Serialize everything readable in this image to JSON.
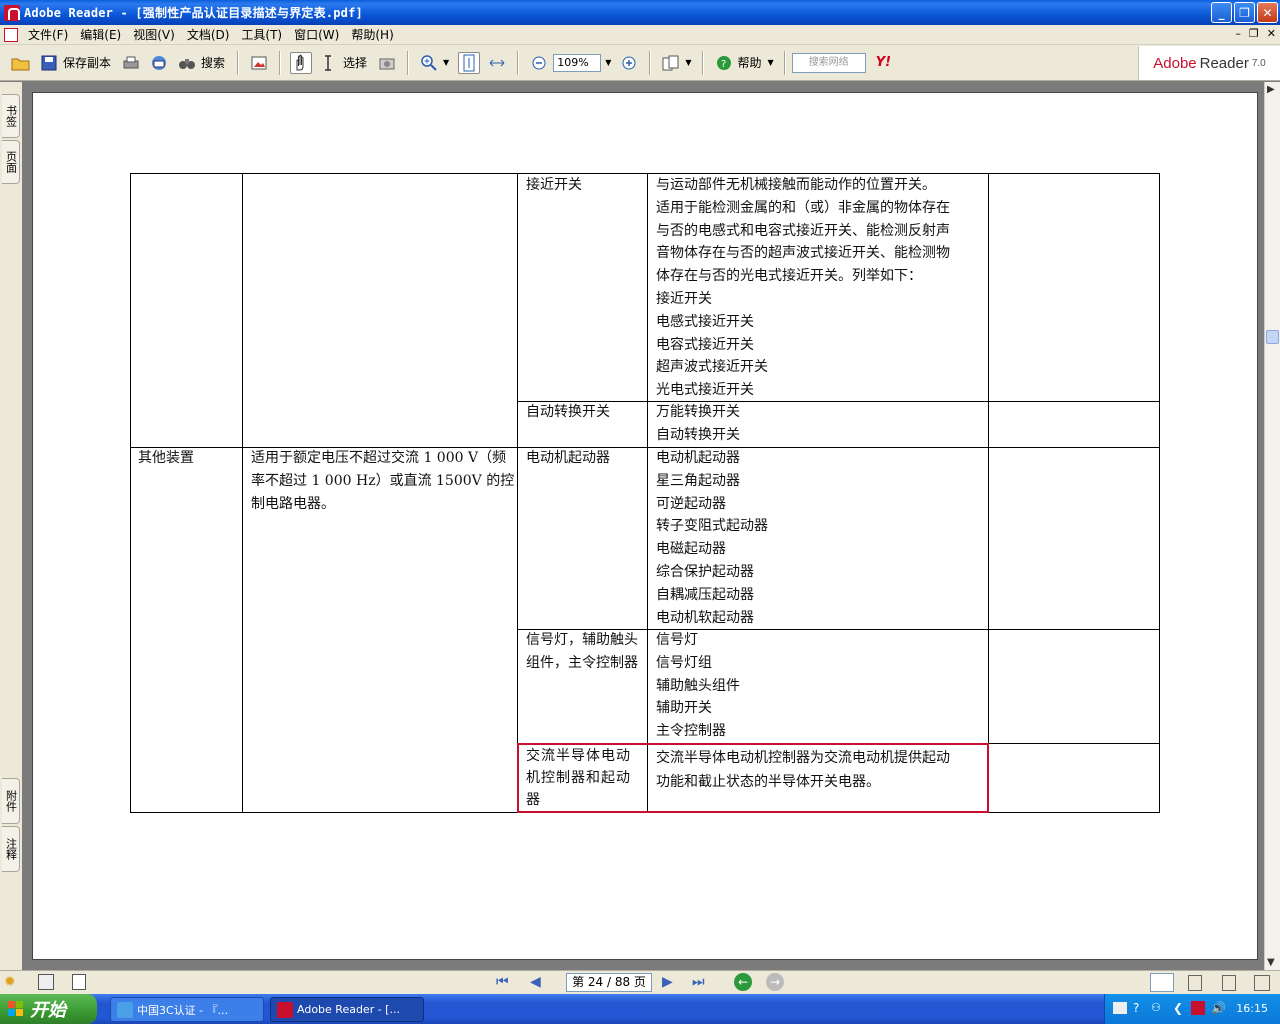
{
  "window": {
    "title": "Adobe Reader - [强制性产品认证目录描述与界定表.pdf]"
  },
  "menu": {
    "items": [
      "文件(F)",
      "编辑(E)",
      "视图(V)",
      "文档(D)",
      "工具(T)",
      "窗口(W)",
      "帮助(H)"
    ]
  },
  "toolbar": {
    "save_copy_label": "保存副本",
    "search_label": "搜索",
    "select_label": "选择",
    "zoom_value": "109%",
    "help_label": "帮助",
    "search_web_placeholder": "搜索网络",
    "yahoo_label": "Y!",
    "brand": {
      "adobe": "Adobe",
      "reader": "Reader",
      "version": "7.0"
    }
  },
  "sidenav": {
    "tabs_top": [
      "书签",
      "页面"
    ],
    "tabs_bottom": [
      "附件",
      "注释"
    ]
  },
  "table": {
    "rows": [
      {
        "col1": "",
        "col2": "",
        "col3": "接近开关",
        "col4": [
          "与运动部件无机械接触而能动作的位置开关。",
          "适用于能检测金属的和（或）非金属的物体存在",
          "与否的电感式和电容式接近开关、能检测反射声",
          "音物体存在与否的超声波式接近开关、能检测物",
          "体存在与否的光电式接近开关。列举如下：",
          "接近开关",
          "电感式接近开关",
          "电容式接近开关",
          "超声波式接近开关",
          "光电式接近开关"
        ]
      },
      {
        "col3": "自动转换开关",
        "col4": [
          "万能转换开关",
          "自动转换开关"
        ]
      },
      {
        "col1": "其他装置",
        "col2": [
          "适用于额定电压不超过交流 1 000 V（频",
          "率不超过 1 000 Hz）或直流 1500V 的控",
          "制电路电器。"
        ],
        "col3": "电动机起动器",
        "col4": [
          "电动机起动器",
          "星三角起动器",
          "可逆起动器",
          "转子变阻式起动器",
          "电磁起动器",
          "综合保护起动器",
          "自耦减压起动器",
          "电动机软起动器"
        ]
      },
      {
        "col3": [
          "信号灯，辅助触头",
          "组件，主令控制器"
        ],
        "col4": [
          "信号灯",
          "信号灯组",
          "辅助触头组件",
          "辅助开关",
          "主令控制器"
        ]
      },
      {
        "col3": [
          "交流半导体电动",
          "机控制器和起动",
          "器"
        ],
        "col4": [
          "交流半导体电动机控制器为交流电动机提供起动",
          "功能和截止状态的半导体开关电器。"
        ]
      }
    ]
  },
  "navigation": {
    "page_display": "第 24 / 88 页"
  },
  "taskbar": {
    "start_label": "开始",
    "tasks": [
      "中国3C认证 - 『...",
      "Adobe Reader - [..."
    ],
    "clock": "16:15"
  },
  "colors": {
    "title_bar": "#0a56d6",
    "chrome": "#ece9d8",
    "selection_red": "#c8102e",
    "taskbar": "#2356d4"
  }
}
